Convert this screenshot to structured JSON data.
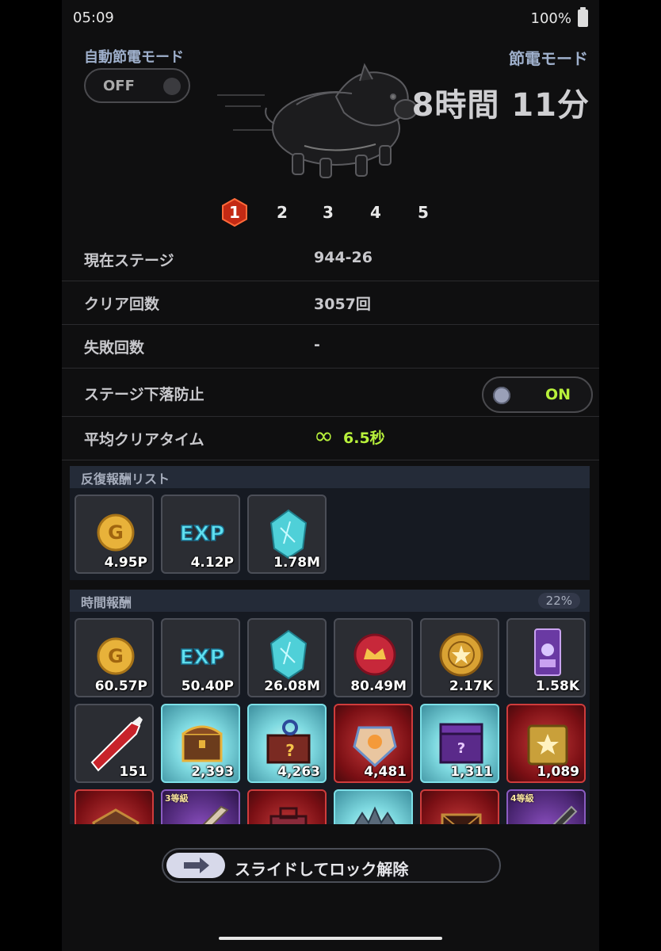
{
  "status_bar": {
    "time": "05:09",
    "battery": "100%"
  },
  "power_save": {
    "auto_label": "自動節電モード",
    "auto_state": "OFF",
    "mode_label": "節電モード",
    "remaining": "8時間 11分"
  },
  "pages": [
    {
      "label": "1",
      "active": true
    },
    {
      "label": "2",
      "active": false
    },
    {
      "label": "3",
      "active": false
    },
    {
      "label": "4",
      "active": false
    },
    {
      "label": "5",
      "active": false
    }
  ],
  "stats": {
    "current_stage": {
      "label": "現在ステージ",
      "value": "944-26"
    },
    "clear_count": {
      "label": "クリア回数",
      "value": "3057回"
    },
    "fail_count": {
      "label": "失敗回数",
      "value": "-"
    },
    "stage_drop": {
      "label": "ステージ下落防止",
      "state": "ON"
    },
    "avg_clear": {
      "label": "平均クリアタイム",
      "value": "6.5秒"
    }
  },
  "repeat_rewards": {
    "title": "反復報酬リスト",
    "items": [
      {
        "icon": "gold-coin-icon",
        "value": "4.95P"
      },
      {
        "icon": "exp-icon",
        "value": "4.12P"
      },
      {
        "icon": "crystal-icon",
        "value": "1.78M"
      }
    ]
  },
  "time_rewards": {
    "title": "時間報酬",
    "percent": "22%",
    "row1": [
      {
        "icon": "gold-coin-icon",
        "value": "60.57P"
      },
      {
        "icon": "exp-icon",
        "value": "50.40P"
      },
      {
        "icon": "crystal-icon",
        "value": "26.08M"
      },
      {
        "icon": "wax-seal-icon",
        "value": "80.49M"
      },
      {
        "icon": "medal-icon",
        "value": "2.17K"
      },
      {
        "icon": "scroll-card-icon",
        "value": "1.58K"
      }
    ],
    "row2": [
      {
        "icon": "red-pencil-icon",
        "value": "151"
      },
      {
        "icon": "treasure-chest-icon",
        "value": "2,393"
      },
      {
        "icon": "mystery-box-icon",
        "value": "4,263"
      },
      {
        "icon": "crest-chest-icon",
        "value": "4,481"
      },
      {
        "icon": "purple-mystery-chest-icon",
        "value": "1,311"
      },
      {
        "icon": "gold-chest-icon",
        "value": "1,089"
      }
    ],
    "row3": [
      {
        "icon": "red-chest-icon",
        "grade": ""
      },
      {
        "icon": "sword-icon",
        "grade": "3等級"
      },
      {
        "icon": "red-box-icon",
        "grade": ""
      },
      {
        "icon": "crown-icon",
        "grade": ""
      },
      {
        "icon": "dark-chest-icon",
        "grade": ""
      },
      {
        "icon": "blade-icon",
        "grade": "4等級"
      }
    ]
  },
  "unlock": {
    "label": "スライドしてロック解除"
  },
  "colors": {
    "accent_green": "#b8f13b",
    "label_blue": "#9fb0cc",
    "page_active": "#e8421f"
  }
}
